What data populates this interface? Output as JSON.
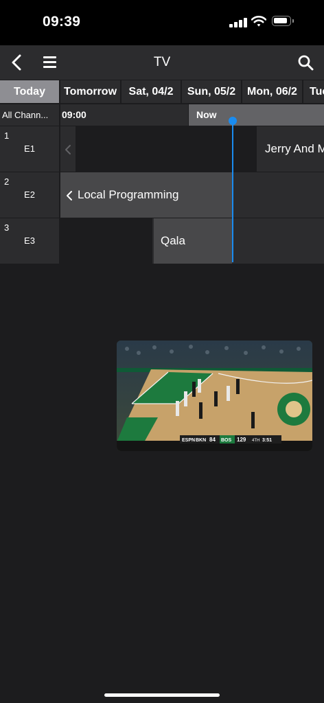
{
  "status_bar": {
    "time": "09:39"
  },
  "nav": {
    "title": "TV"
  },
  "day_tabs": [
    "Today",
    "Tomorrow",
    "Sat, 04/2",
    "Sun, 05/2",
    "Mon, 06/2",
    "Tue"
  ],
  "timeline": {
    "all_channels_label": "All Chann...",
    "time_label": "09:00",
    "now_label": "Now"
  },
  "channels": [
    {
      "number": "1",
      "name": "E1",
      "program": "Jerry And M"
    },
    {
      "number": "2",
      "name": "E2",
      "program": "Local Programming"
    },
    {
      "number": "3",
      "name": "E3",
      "program": "Qala"
    }
  ],
  "video": {
    "scorebug": {
      "network": "ESPN",
      "team_away": "BKN",
      "score_away": "84",
      "team_home": "BOS",
      "score_home": "129",
      "quarter": "4TH",
      "clock": "3:51"
    }
  },
  "colors": {
    "accent": "#1a8cf0",
    "active_tab": "#8e8e93",
    "cell_bg": "#2c2c2e",
    "now_bg": "#636366"
  }
}
